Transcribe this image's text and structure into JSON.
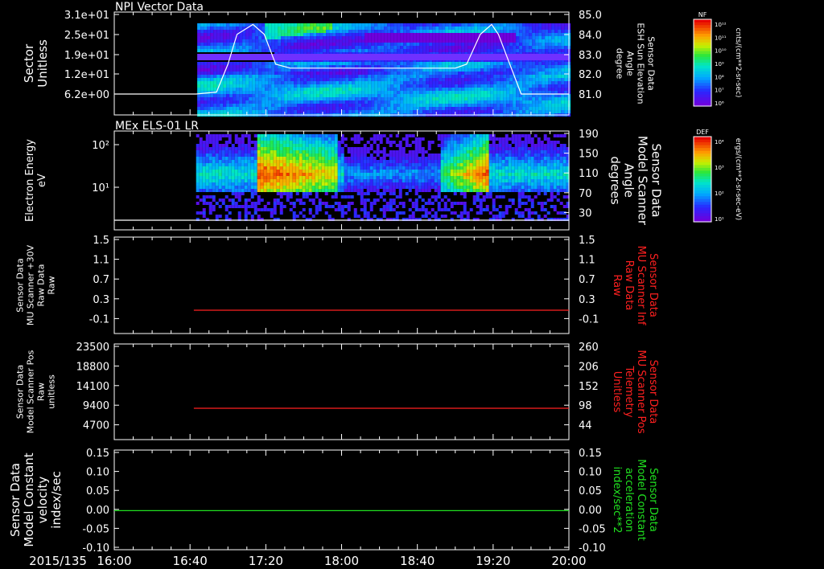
{
  "date_label": "2015/135",
  "x_ticks": [
    "16:00",
    "16:40",
    "17:20",
    "18:00",
    "18:40",
    "19:20",
    "20:00"
  ],
  "colors": {
    "background": "#000000",
    "axis": "#ffffff",
    "red_series": "#ff2020",
    "green_series": "#20e020"
  },
  "colorbars": [
    {
      "title": "NF",
      "unit": "cnts/(cm**2-sr-sec)",
      "ticks": [
        "10¹²",
        "10¹¹",
        "10¹⁰",
        "10⁹",
        "10⁸",
        "10⁷",
        "10⁶"
      ]
    },
    {
      "title": "DEF",
      "unit": "ergs/(cm**2-sr-sec-eV)",
      "ticks": [
        "10⁴",
        "10³",
        "10²",
        "10¹"
      ]
    }
  ],
  "chart_data": [
    {
      "type": "heatmap",
      "title": "NPI Vector Data",
      "ylabel": "Sector\nUnitless",
      "y_ticks": [
        "3.1e+01",
        "2.5e+01",
        "1.9e+01",
        "1.2e+01",
        "6.2e+00"
      ],
      "y2label": "Sensor Data\nESH Sun Elevation\nAngle\ndegree",
      "y2_ticks": [
        "85.0",
        "84.0",
        "83.0",
        "82.0",
        "81.0"
      ],
      "y2lim": [
        80.2,
        85.0
      ],
      "overlay_line": {
        "x_hours": [
          16.0,
          16.72,
          16.9,
          17.0,
          17.08,
          17.22,
          17.32,
          17.42,
          17.55,
          18.0,
          19.0,
          19.1,
          19.22,
          19.32,
          19.38,
          19.48,
          19.58,
          20.0
        ],
        "values": [
          81.0,
          81.0,
          81.1,
          82.5,
          84.0,
          84.5,
          84.0,
          82.5,
          82.3,
          82.3,
          82.3,
          82.5,
          84.0,
          84.5,
          84.0,
          82.5,
          81.0,
          81.0
        ]
      },
      "data_start_hour": 16.73
    },
    {
      "type": "heatmap",
      "title": "MEx ELS-01 LR",
      "ylabel": "Electron Energy\neV",
      "y_ticks": [
        "10²",
        "10¹"
      ],
      "y2label": "Sensor Data\nModel Scanner\nAngle\ndegrees",
      "y2_ticks": [
        "190",
        "150",
        "110",
        "70",
        "30"
      ],
      "y2lim": [
        0,
        190
      ],
      "overlay_line": {
        "x_hours": [
          16.0,
          20.0
        ],
        "values": [
          0,
          0
        ]
      },
      "data_start_hour": 16.72
    },
    {
      "type": "line",
      "ylabel": "Sensor Data\nMU Scanner +30V\nRaw Data\nRaw",
      "y_ticks": [
        "1.5",
        "1.1",
        "0.7",
        "0.3",
        "-0.1"
      ],
      "ylim": [
        -0.5,
        1.5
      ],
      "y2label": "Sensor Data\nMU Scanner Inf\nRaw Data\nRaw",
      "y2_ticks": [
        "1.5",
        "1.1",
        "0.7",
        "0.3",
        "-0.1"
      ],
      "series": [
        {
          "x_hours": [
            16.7,
            20.0
          ],
          "values": [
            0.0,
            0.0
          ],
          "color": "#ff2020"
        }
      ]
    },
    {
      "type": "line",
      "ylabel": "Sensor Data\nModel Scanner Pos\nRaw\nunitless",
      "y_ticks": [
        "23500",
        "18800",
        "14100",
        "9400",
        "4700"
      ],
      "ylim": [
        0,
        23500
      ],
      "y2label": "Sensor Data\nMU Scanner Pos\nTelemetry\nUnitless",
      "y2_ticks": [
        "260",
        "206",
        "152",
        "98",
        "44"
      ],
      "series": [
        {
          "x_hours": [
            16.7,
            20.0
          ],
          "values": [
            8000,
            8000
          ],
          "color": "#ff2020"
        }
      ]
    },
    {
      "type": "line",
      "ylabel": "Sensor Data\nModel Constant\nvelocity\nindex/sec",
      "y_ticks": [
        "0.15",
        "0.10",
        "0.05",
        "0.00",
        "-0.05",
        "-0.10"
      ],
      "ylim": [
        -0.1,
        0.15
      ],
      "y2label": "Sensor Data\nModel Constant\nacceleration\nindex/sec**2",
      "y2_ticks": [
        "0.15",
        "0.10",
        "0.05",
        "0.00",
        "-0.05",
        "-0.10"
      ],
      "series": [
        {
          "x_hours": [
            16.0,
            20.0
          ],
          "values": [
            0.0,
            0.0
          ],
          "color": "#20e020"
        }
      ]
    }
  ]
}
